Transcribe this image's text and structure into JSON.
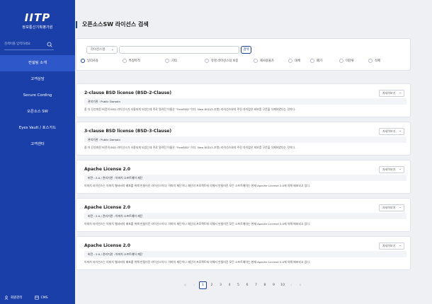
{
  "brand": {
    "logo": "IITP",
    "subtitle": "정보통신기획평가원"
  },
  "sidebar": {
    "search_placeholder": "검색어를 입력하세요",
    "items": [
      {
        "label": "컨설팅 소개",
        "active": true
      },
      {
        "label": "고객상담",
        "active": false
      },
      {
        "label": "Secure Cording",
        "active": false
      },
      {
        "label": "오픈소스 SW",
        "active": false
      },
      {
        "label": "Eyes Vault / 포스가드",
        "active": false
      },
      {
        "label": "고객센터",
        "active": false
      }
    ],
    "bottom": {
      "member_label": "회원관리",
      "cms_label": "CMS"
    }
  },
  "page": {
    "title": "오픈소스SW 라이선스 검색"
  },
  "search": {
    "select_value": "라이선스명",
    "input_value": "",
    "button_label": "검색",
    "filters": [
      {
        "label": "널리사용",
        "selected": true
      },
      {
        "label": "특정목적",
        "selected": false
      },
      {
        "label": "기타",
        "selected": false
      },
      {
        "label": "유명 라이선스의 보증",
        "selected": false
      },
      {
        "label": "재사용불가",
        "selected": false
      },
      {
        "label": "대체",
        "selected": false
      },
      {
        "label": "폐기",
        "selected": false
      },
      {
        "label": "미분류",
        "selected": false
      },
      {
        "label": "삭제",
        "selected": false
      }
    ]
  },
  "results": [
    {
      "title": "2-clause BSD license (BSD-2-Clause)",
      "more_label": "자세히보기",
      "meta": "관리기관 : Public Domain",
      "desc": "좀 더 단순화된 버전의 BSD 라이선스가 사용되게 되었는데 주로 알려진 이름은 \"FreeBSD\" 이다. New BSD(3-조항) 라이선스와의 주된 차이점은 비보증 구문을 삭제하였다는 것이다."
    },
    {
      "title": "3-clause BSD license (BSD-3-Clause)",
      "more_label": "자세히보기",
      "meta": "관리기관 : Public Domain",
      "desc": "좀 더 단순화된 버전의 BSD 라이선스가 사용되게 되었는데 주로 알려진 이름은 \"FreeBSD\" 이다. New BSD(3-조항) 라이선스와의 주된 차이점은 비보증 구문을 삭제하였다는 것이다."
    },
    {
      "title": "Apache License 2.0",
      "more_label": "자세히보기",
      "meta": "버전 : 2.0  /  관리기관 : 아파치 소프트웨어 재단",
      "desc": "아파치 라이선스는 아파치 웹서버의 배포를 위해 만들어진 라이선스이다. 아파치 재단이나 재단의 프로젝트에 의해서 만들어진 모든 소프트웨어는 현재 Apache License 2.0에 의해 배포되고 있다."
    },
    {
      "title": "Apache License 2.0",
      "more_label": "자세히보기",
      "meta": "버전 : 2.0  /  관리기관 : 아파치 소프트웨어 재단",
      "desc": "아파치 라이선스는 아파치 웹서버의 배포를 위해 만들어진 라이선스이다. 아파치 재단이나 재단의 프로젝트에 의해서 만들어진 모든 소프트웨어는 현재 Apache License 2.0에 의해 배포되고 있다."
    },
    {
      "title": "Apache License 2.0",
      "more_label": "자세히보기",
      "meta": "버전 : 2.0  /  관리기관 : 아파치 소프트웨어 재단",
      "desc": "아파치 라이선스는 아파치 웹서버의 배포를 위해 만들어진 라이선스이다. 아파치 재단이나 재단의 프로젝트에 의해서 만들어진 모든 소프트웨어는 현재 Apache License 2.0에 의해 배포되고 있다."
    }
  ],
  "pagination": {
    "first": "«",
    "prev": "‹",
    "next": "›",
    "last": "»",
    "pages": [
      "1",
      "2",
      "3",
      "4",
      "5",
      "6",
      "7",
      "8",
      "9",
      "10"
    ],
    "current": "1"
  },
  "colors": {
    "brand": "#1a3fa8",
    "active_menu": "#2e58c9",
    "background": "#eef0f4"
  }
}
